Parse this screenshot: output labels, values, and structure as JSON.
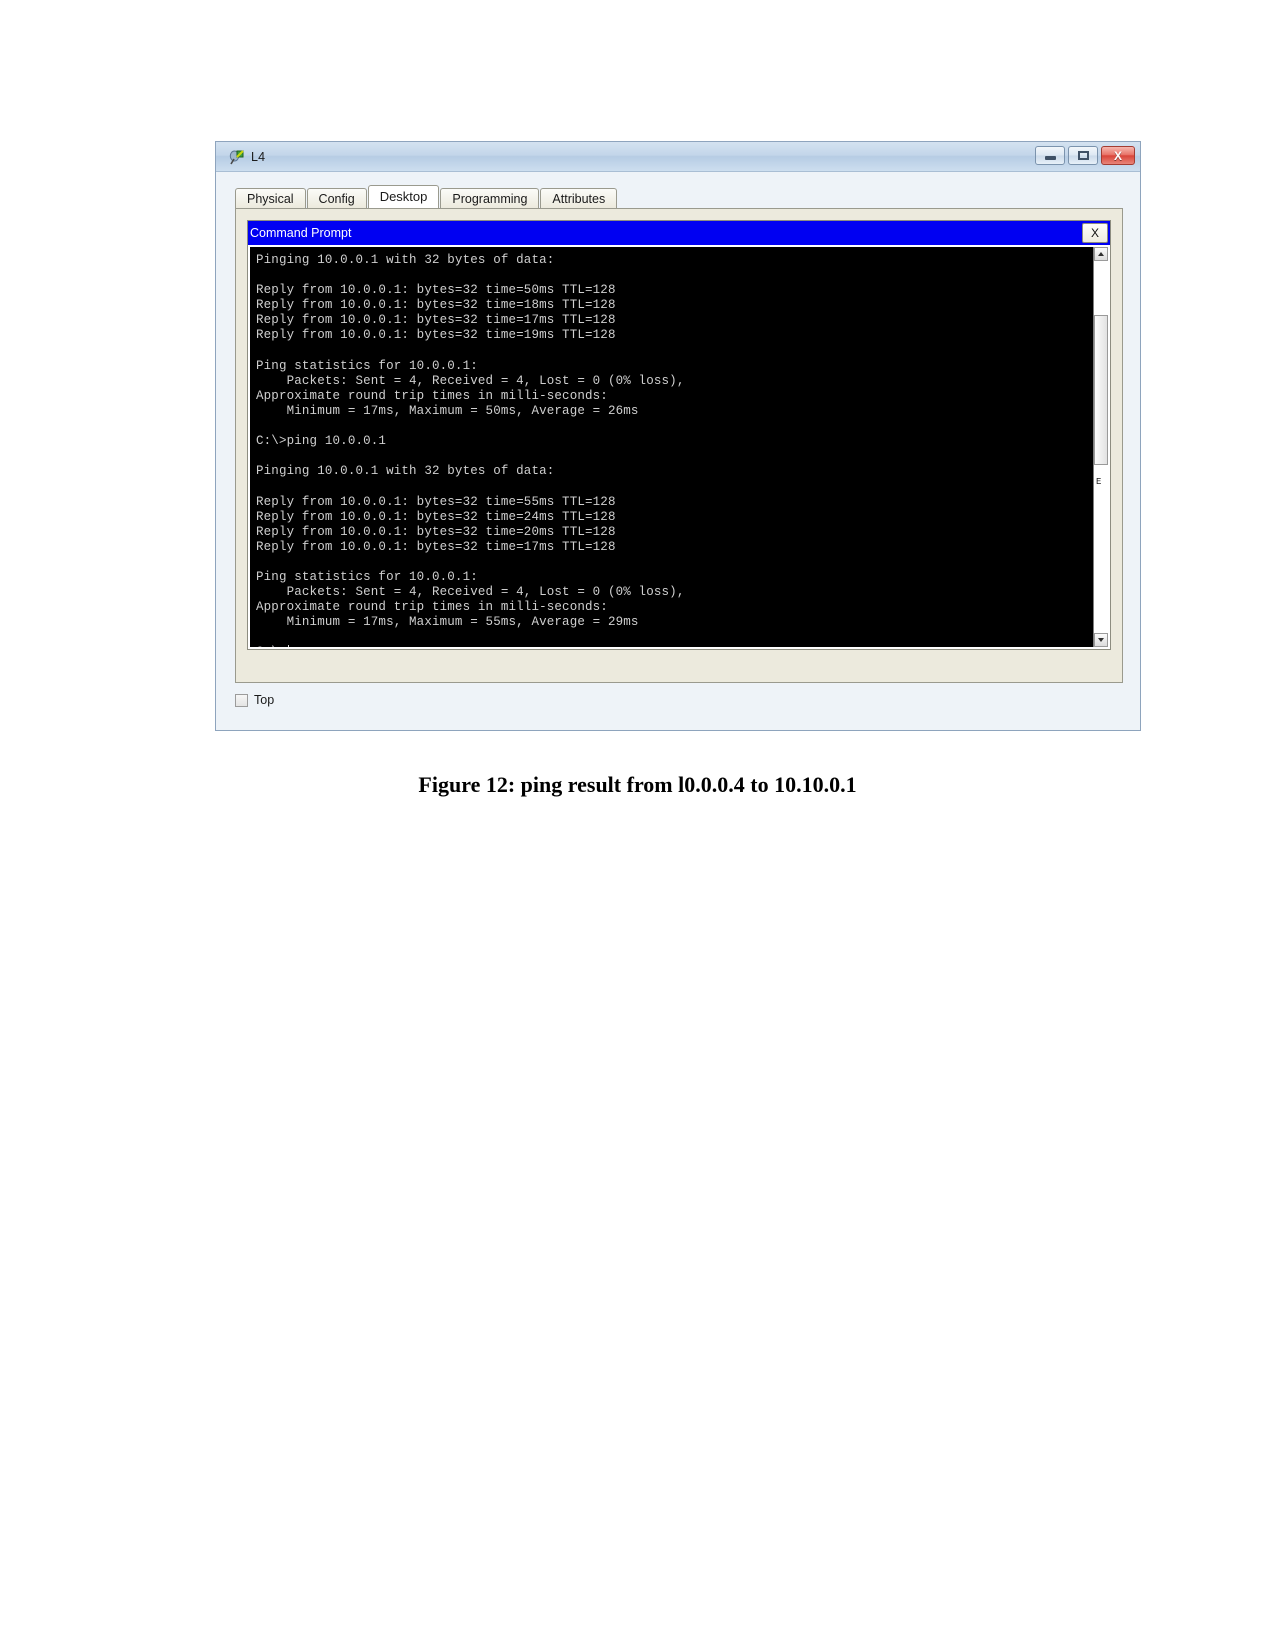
{
  "window": {
    "title": "L4",
    "icon": "device-icon",
    "buttons": [
      {
        "name": "minimize-button",
        "glyph": "minimize-icon",
        "label": ""
      },
      {
        "name": "maximize-button",
        "glyph": "maximize-icon",
        "label": ""
      },
      {
        "name": "close-button",
        "glyph": "close-icon",
        "label": "X"
      }
    ]
  },
  "tabs": [
    {
      "label": "Physical",
      "active": false
    },
    {
      "label": "Config",
      "active": false
    },
    {
      "label": "Desktop",
      "active": true
    },
    {
      "label": "Programming",
      "active": false
    },
    {
      "label": "Attributes",
      "active": false
    }
  ],
  "command_prompt": {
    "title": "Command Prompt",
    "close_label": "X",
    "scrollbar": {
      "mark": "E"
    },
    "lines": [
      "Pinging 10.0.0.1 with 32 bytes of data:",
      "",
      "Reply from 10.0.0.1: bytes=32 time=50ms TTL=128",
      "Reply from 10.0.0.1: bytes=32 time=18ms TTL=128",
      "Reply from 10.0.0.1: bytes=32 time=17ms TTL=128",
      "Reply from 10.0.0.1: bytes=32 time=19ms TTL=128",
      "",
      "Ping statistics for 10.0.0.1:",
      "    Packets: Sent = 4, Received = 4, Lost = 0 (0% loss),",
      "Approximate round trip times in milli-seconds:",
      "    Minimum = 17ms, Maximum = 50ms, Average = 26ms",
      "",
      "C:\\>ping 10.0.0.1",
      "",
      "Pinging 10.0.0.1 with 32 bytes of data:",
      "",
      "Reply from 10.0.0.1: bytes=32 time=55ms TTL=128",
      "Reply from 10.0.0.1: bytes=32 time=24ms TTL=128",
      "Reply from 10.0.0.1: bytes=32 time=20ms TTL=128",
      "Reply from 10.0.0.1: bytes=32 time=17ms TTL=128",
      "",
      "Ping statistics for 10.0.0.1:",
      "    Packets: Sent = 4, Received = 4, Lost = 0 (0% loss),",
      "Approximate round trip times in milli-seconds:",
      "    Minimum = 17ms, Maximum = 55ms, Average = 29ms",
      "",
      "C:\\>"
    ],
    "prompt_line_index": 26
  },
  "footer": {
    "top_checkbox_label": "Top",
    "top_checked": false
  },
  "caption": {
    "text": "Figure 12: ping result from l0.0.0.4 to 10.10.0.1"
  },
  "colors": {
    "cmd_titlebar": "#0000f2",
    "terminal_bg": "#000000",
    "terminal_fg": "#cfcfcf",
    "close_button": "#d9453a"
  }
}
